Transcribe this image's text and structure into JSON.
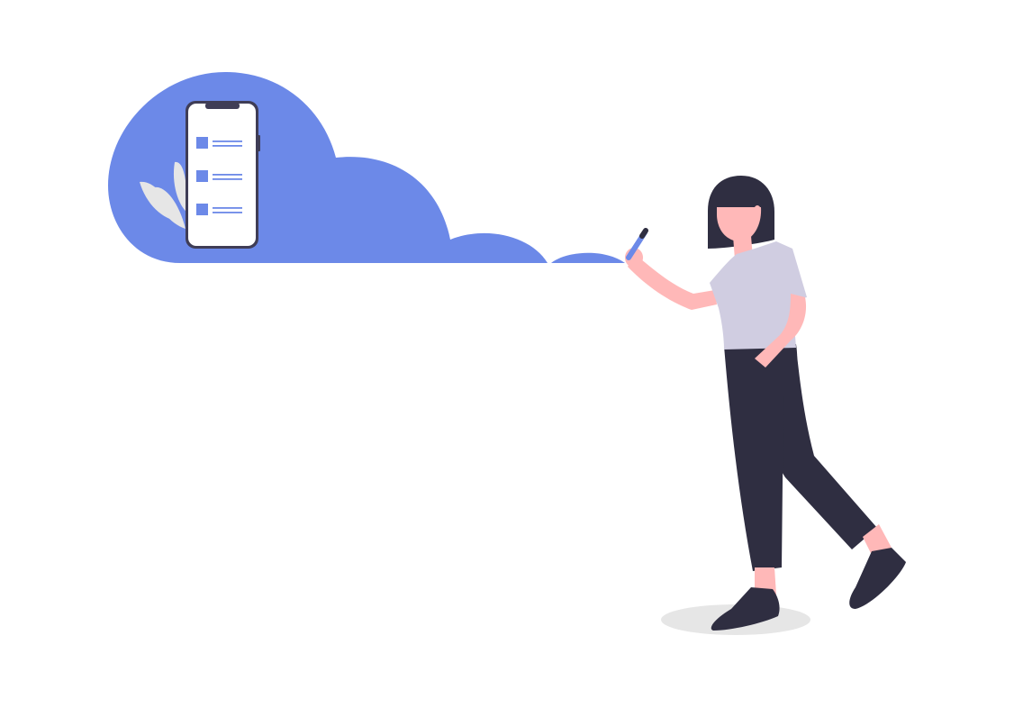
{
  "illustration": {
    "kind": "flat vector illustration",
    "elements": [
      "cloud",
      "smartphone",
      "checklist",
      "plant-leaves",
      "person",
      "pen",
      "ground-shadow"
    ]
  },
  "phone": {
    "checklist_item_count": 3
  },
  "colors": {
    "background": "#ffffff",
    "accent": "#6c89e8",
    "phone_frame": "#3f3d56",
    "phone_screen": "#ffffff",
    "leaf": "#e6e6e6",
    "skin": "#ffb8b8",
    "hair": "#2f2e41",
    "shirt": "#d0cde1",
    "pants": "#2f2e41",
    "shoes": "#2f2e41",
    "shadow": "#e6e6e6"
  }
}
